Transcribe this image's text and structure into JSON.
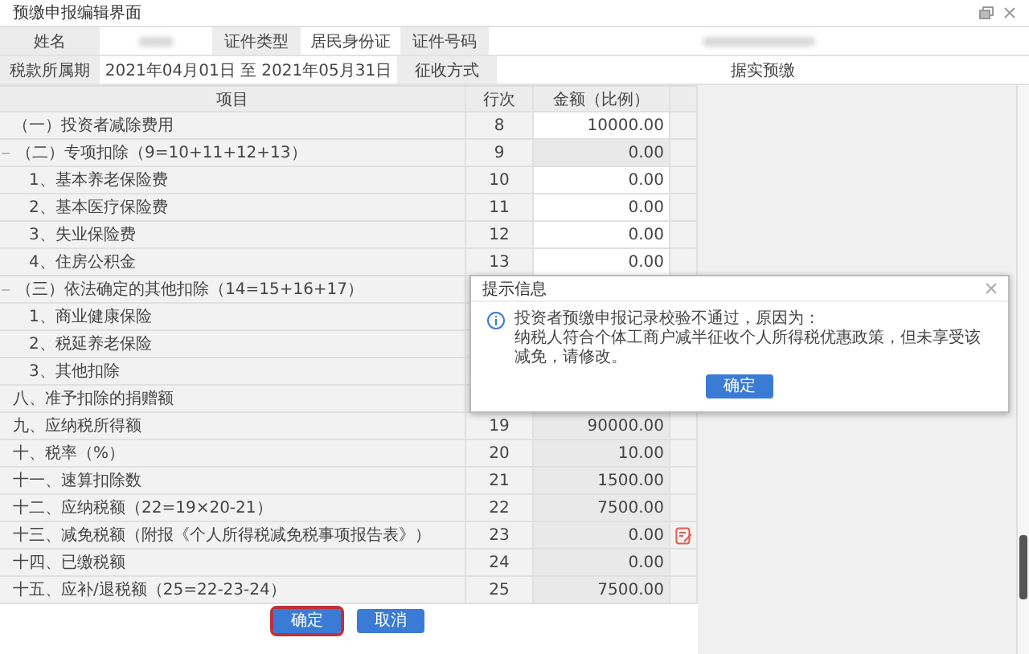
{
  "window": {
    "title": "预缴申报编辑界面"
  },
  "taxpayer": {
    "name_label": "姓名",
    "id_type_label": "证件类型",
    "id_type": "居民身份证",
    "id_number_label": "证件号码",
    "period_label": "税款所属期",
    "period": "2021年04月01日 至 2021年05月31日",
    "collection_label": "征收方式",
    "collection_method": "据实预缴"
  },
  "table": {
    "columns": [
      "项目",
      "行次",
      "金额（比例）"
    ],
    "rows": [
      {
        "label": "（一）投资者减除费用",
        "line": "8",
        "amount": "10000.00",
        "editable": true,
        "edit_icon": false
      },
      {
        "label": "（二）专项扣除（9=10+11+12+13）",
        "line": "9",
        "amount": "0.00",
        "editable": false,
        "edit_icon": false,
        "expanded": true,
        "children": [
          {
            "label": "1、基本养老保险费",
            "line": "10",
            "amount": "0.00",
            "editable": true,
            "edit_icon": false
          },
          {
            "label": "2、基本医疗保险费",
            "line": "11",
            "amount": "0.00",
            "editable": true,
            "edit_icon": false
          },
          {
            "label": "3、失业保险费",
            "line": "12",
            "amount": "0.00",
            "editable": true,
            "edit_icon": false
          },
          {
            "label": "4、住房公积金",
            "line": "13",
            "amount": "0.00",
            "editable": true,
            "edit_icon": false
          }
        ]
      },
      {
        "label": "（三）依法确定的其他扣除（14=15+16+17）",
        "expanded": true,
        "children": [
          {
            "label": "1、商业健康保险"
          },
          {
            "label": "2、税延养老保险"
          },
          {
            "label": "3、其他扣除"
          }
        ]
      },
      {
        "label": "八、准予扣除的捐赠额"
      },
      {
        "label": "九、应纳税所得额",
        "line": "19",
        "amount": "90000.00",
        "editable": false,
        "edit_icon": false
      },
      {
        "label": "十、税率（%）",
        "line": "20",
        "amount": "10.00",
        "editable": false,
        "edit_icon": false
      },
      {
        "label": "十一、速算扣除数",
        "line": "21",
        "amount": "1500.00",
        "editable": false,
        "edit_icon": false
      },
      {
        "label": "十二、应纳税额（22=19×20-21）",
        "line": "22",
        "amount": "7500.00",
        "editable": false,
        "edit_icon": false
      },
      {
        "label": "十三、减免税额（附报《个人所得税减免税事项报告表》）",
        "line": "23",
        "amount": "0.00",
        "editable": false,
        "edit_icon": true
      },
      {
        "label": "十四、已缴税额",
        "line": "24",
        "amount": "0.00",
        "editable": false,
        "edit_icon": false
      },
      {
        "label": "十五、应补/退税额（25=22-23-24）",
        "line": "25",
        "amount": "7500.00",
        "editable": false,
        "edit_icon": false
      }
    ]
  },
  "dialog": {
    "title": "提示信息",
    "message": [
      "投资者预缴申报记录校验不通过，原因为：",
      "纳税人符合个体工商户减半征收个人所得税优惠政策，但未享受该减免，请修改。"
    ],
    "button": "确定"
  },
  "buttons": [
    {
      "label": "确定",
      "focused": true
    },
    {
      "label": "取消",
      "focused": false
    }
  ]
}
